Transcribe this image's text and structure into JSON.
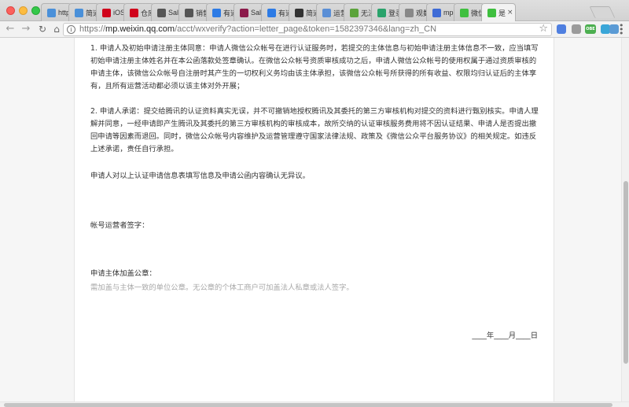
{
  "browser": {
    "tabs": [
      {
        "title": "http",
        "icon": "doc-icon",
        "color": "#4a90d9"
      },
      {
        "title": "简道",
        "icon": "doc-icon",
        "color": "#4a90d9"
      },
      {
        "title": "iOS",
        "icon": "c-icon",
        "color": "#d0021b"
      },
      {
        "title": "仓库",
        "icon": "c-icon",
        "color": "#d0021b"
      },
      {
        "title": "Sal",
        "icon": "book-icon",
        "color": "#555555"
      },
      {
        "title": "销售",
        "icon": "book-icon",
        "color": "#555555"
      },
      {
        "title": "有道",
        "icon": "youdao-icon",
        "color": "#2d7be5"
      },
      {
        "title": "Sale",
        "icon": "s-icon",
        "color": "#8b1a4a"
      },
      {
        "title": "有道",
        "icon": "youdao-icon",
        "color": "#2d7be5"
      },
      {
        "title": "简道",
        "icon": "octocat-icon",
        "color": "#333333"
      },
      {
        "title": "运营",
        "icon": "doc-icon",
        "color": "#5b8fd6"
      },
      {
        "title": "无法",
        "icon": "puzzle-icon",
        "color": "#5ca33b"
      },
      {
        "title": "登录",
        "icon": "leaf-icon",
        "color": "#2aa36b"
      },
      {
        "title": "观数",
        "icon": "doc-icon",
        "color": "#888888"
      },
      {
        "title": "mp.",
        "icon": "paw-icon",
        "color": "#3e6bd6"
      },
      {
        "title": "微信",
        "icon": "wechat-icon",
        "color": "#3fbf3f"
      },
      {
        "title": "是",
        "icon": "wechat-icon",
        "color": "#3fbf3f",
        "active": true
      }
    ],
    "url_domain": "mp.weixin.qq.com",
    "url_scheme": "https://",
    "url_path": "/acct/wxverify?action=letter_page&token=1582397346&lang=zh_CN",
    "extensions": [
      {
        "name": "extension-blue-icon",
        "color": "#4f7fe0"
      },
      {
        "name": "extension-gray-icon",
        "color": "#9b9b9b"
      },
      {
        "name": "extension-green-label",
        "color": "#4caf50",
        "text": "OBE"
      },
      {
        "name": "extension-drop-icon",
        "color": "#3aa6d8"
      },
      {
        "name": "extension-cart-icon",
        "color": "#5b9bd5"
      }
    ]
  },
  "letter": {
    "paragraph_1": "1. 申请人及初始申请注册主体同意：申请人微信公众帐号在进行认证服务时，若提交的主体信息与初始申请注册主体信息不一致，应当填写初始申请注册主体姓名并在本公函落款处签章确认。在微信公众帐号资质审核成功之后，申请人微信公众帐号的使用权属于通过资质审核的申请主体，该微信公众帐号自注册时其产生的一切权利义务均由该主体承担，该微信公众帐号所获得的所有收益、权限均归认证后的主体享有，且所有运营活动都必须以该主体对外开展；",
    "paragraph_2": "2. 申请人承诺：提交给腾讯的认证资料真实无误，并不可撤销地授权腾讯及其委托的第三方审核机构对提交的资料进行甄别核实。申请人理解并同意，一经申请即产生腾讯及其委托的第三方审核机构的审核成本，故所交纳的认证审核服务费用将不因认证结果、申请人是否提出撤回申请等因素而退回。同时，微信公众帐号内容维护及运营管理遵守国家法律法规、政策及《微信公众平台服务协议》的相关规定。如违反上述承诺，责任自行承担。",
    "paragraph_3": "申请人对以上认证申请信息表填写信息及申请公函内容确认无异议。",
    "operator_signature_label": "帐号运营者签字：",
    "seal_label": "申请主体加盖公章：",
    "seal_note": "需加盖与主体一致的单位公章。无公章的个体工商户可加盖法人私章或法人签字。",
    "date_line": "____年____月____日"
  }
}
